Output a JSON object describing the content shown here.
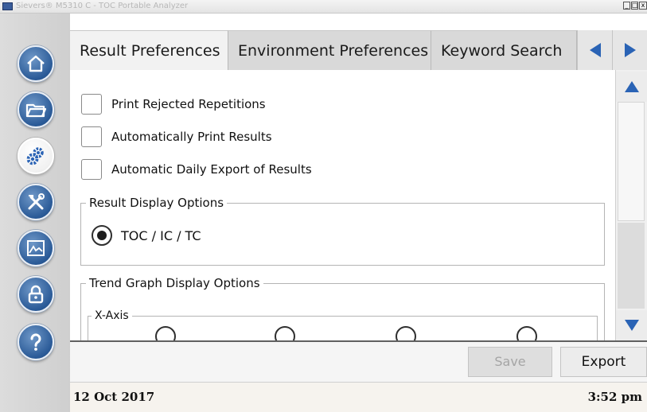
{
  "window": {
    "title": "Sievers® M5310 C - TOC Portable Analyzer",
    "min_label": "_",
    "max_label": "□",
    "close_label": "x"
  },
  "sidebar": {
    "items": [
      {
        "icon": "home-icon"
      },
      {
        "icon": "folder-icon"
      },
      {
        "icon": "gear-icon",
        "active": true
      },
      {
        "icon": "tools-icon"
      },
      {
        "icon": "graph-icon"
      },
      {
        "icon": "lock-icon"
      },
      {
        "icon": "help-icon"
      }
    ]
  },
  "tabs": [
    {
      "label": "Result Preferences",
      "active": true
    },
    {
      "label": "Environment Preferences"
    },
    {
      "label": "Keyword Search"
    }
  ],
  "content": {
    "checkboxes": [
      {
        "label": "Print Rejected Repetitions",
        "checked": false
      },
      {
        "label": "Automatically Print Results",
        "checked": false
      },
      {
        "label": "Automatic Daily Export of Results",
        "checked": false
      }
    ],
    "result_display": {
      "legend": "Result Display Options",
      "option": "TOC / IC / TC",
      "selected": true
    },
    "trend_graph": {
      "legend": "Trend Graph Display Options",
      "x_axis_legend": "X-Axis"
    }
  },
  "buttons": {
    "save": "Save",
    "export": "Export"
  },
  "status": {
    "date": "12 Oct 2017",
    "time": "3:52 pm"
  },
  "colors": {
    "accent_blue": "#2a63b5",
    "sidebar_icon": "#2a5a97"
  }
}
